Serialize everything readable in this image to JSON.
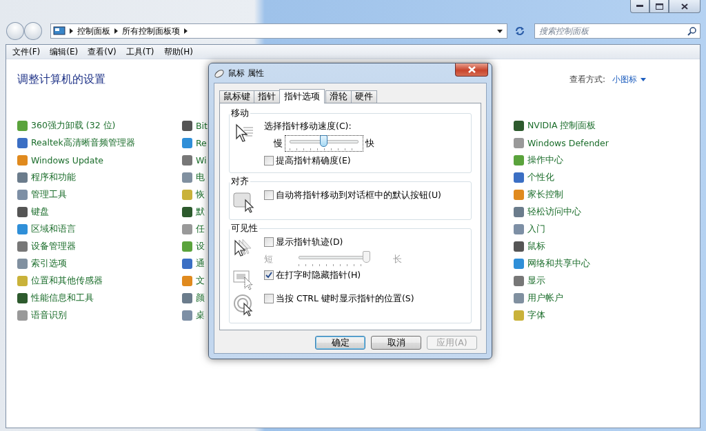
{
  "address_bar": {
    "breadcrumbs": [
      "控制面板",
      "所有控制面板项"
    ]
  },
  "search": {
    "placeholder": "搜索控制面板"
  },
  "menu": [
    "文件(F)",
    "编辑(E)",
    "查看(V)",
    "工具(T)",
    "帮助(H)"
  ],
  "heading": "调整计算机的设置",
  "view_by": {
    "label": "查看方式:",
    "value": "小图标"
  },
  "columns": [
    {
      "items": [
        "360强力卸载 (32 位)",
        "Realtek高清晰音频管理器",
        "Windows Update",
        "程序和功能",
        "管理工具",
        "键盘",
        "区域和语言",
        "设备管理器",
        "索引选项",
        "位置和其他传感器",
        "性能信息和工具",
        "语音识别"
      ]
    },
    {
      "items": [
        "Bit",
        "Re",
        "Wi",
        "电",
        "恢",
        "默",
        "任",
        "设",
        "通",
        "文",
        "颜",
        "桌"
      ]
    },
    {
      "items": [
        "NVIDIA 控制面板",
        "Windows Defender",
        "操作中心",
        "个性化",
        "家长控制",
        "轻松访问中心",
        "入门",
        "鼠标",
        "网络和共享中心",
        "显示",
        "用户帐户",
        "字体"
      ]
    }
  ],
  "dialog": {
    "title": "鼠标 属性",
    "tabs": [
      {
        "label": "鼠标键",
        "selected": false
      },
      {
        "label": "指针",
        "selected": false
      },
      {
        "label": "指针选项",
        "selected": true
      },
      {
        "label": "滑轮",
        "selected": false
      },
      {
        "label": "硬件",
        "selected": false
      }
    ],
    "groups": [
      {
        "title": "移动",
        "blocks": [
          {
            "rows": [
              {
                "kind": "label",
                "text": "选择指针移动速度(C):"
              },
              {
                "kind": "slider",
                "min_label": "慢",
                "max_label": "快",
                "level": 0.5,
                "disabled": false,
                "focused": true
              },
              {
                "kind": "checkbox",
                "label": "提高指针精确度(E)",
                "checked": false
              }
            ]
          }
        ]
      },
      {
        "title": "对齐",
        "blocks": [
          {
            "rows": [
              {
                "kind": "checkbox",
                "label": "自动将指针移动到对话框中的默认按钮(U)",
                "checked": false
              }
            ]
          }
        ]
      },
      {
        "title": "可见性",
        "blocks": [
          {
            "rows": [
              {
                "kind": "checkbox",
                "label": "显示指针轨迹(D)",
                "checked": false
              },
              {
                "kind": "slider",
                "min_label": "短",
                "max_label": "长",
                "level": 1,
                "disabled": true,
                "focused": false
              }
            ]
          },
          {
            "rows": [
              {
                "kind": "checkbox",
                "label": "在打字时隐藏指针(H)",
                "checked": true
              }
            ]
          },
          {
            "rows": [
              {
                "kind": "checkbox",
                "label": "当按 CTRL 键时显示指针的位置(S)",
                "checked": false
              }
            ]
          }
        ]
      }
    ],
    "buttons": [
      {
        "label": "确定",
        "default": true,
        "disabled": false
      },
      {
        "label": "取消",
        "default": false,
        "disabled": false
      },
      {
        "label": "应用(A)",
        "default": false,
        "disabled": true
      }
    ]
  }
}
